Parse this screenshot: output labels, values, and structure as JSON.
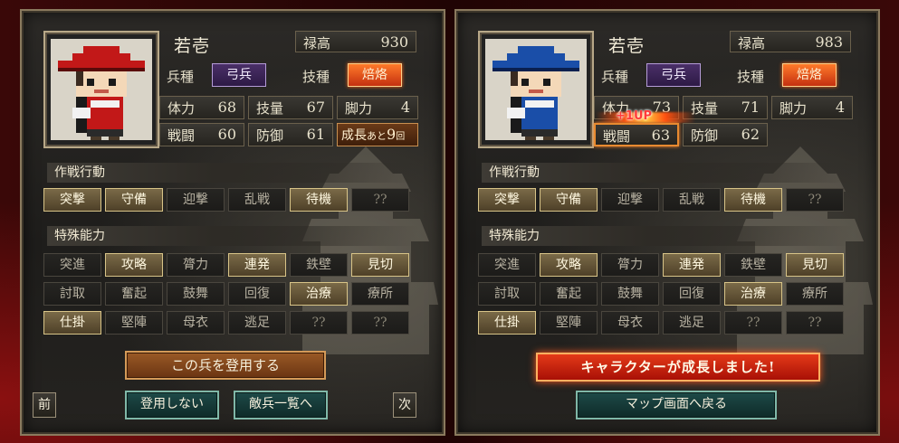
{
  "panels": [
    {
      "name": "若壱",
      "salary_label": "禄高",
      "salary": "930",
      "unit_type_label": "兵種",
      "unit_type": "弓兵",
      "skill_label": "技種",
      "skill": "焙烙",
      "stats": {
        "hp_label": "体力",
        "hp": "68",
        "tech_label": "技量",
        "tech": "67",
        "leg_label": "脚力",
        "leg": "4",
        "atk_label": "戦闘",
        "atk": "60",
        "def_label": "防御",
        "def": "61"
      },
      "growth_prefix": "成長",
      "growth_small": "あと",
      "growth_num": "9",
      "growth_suffix": "回",
      "hat_color": "#c21818",
      "clothes_color": "#c21818",
      "tactics_title": "作戦行動",
      "tactics": [
        {
          "label": "突撃",
          "on": true
        },
        {
          "label": "守備",
          "on": true
        },
        {
          "label": "迎撃",
          "on": false
        },
        {
          "label": "乱戦",
          "on": false
        },
        {
          "label": "待機",
          "on": true
        },
        {
          "label": "??",
          "on": false
        }
      ],
      "abilities_title": "特殊能力",
      "abilities": [
        {
          "label": "突進",
          "on": false
        },
        {
          "label": "攻略",
          "on": true
        },
        {
          "label": "膂力",
          "on": false
        },
        {
          "label": "連発",
          "on": true
        },
        {
          "label": "鉄壁",
          "on": false
        },
        {
          "label": "見切",
          "on": true
        },
        {
          "label": "討取",
          "on": false
        },
        {
          "label": "奮起",
          "on": false
        },
        {
          "label": "鼓舞",
          "on": false
        },
        {
          "label": "回復",
          "on": false
        },
        {
          "label": "治療",
          "on": true
        },
        {
          "label": "療所",
          "on": false
        },
        {
          "label": "仕掛",
          "on": true
        },
        {
          "label": "堅陣",
          "on": false
        },
        {
          "label": "母衣",
          "on": false
        },
        {
          "label": "逃足",
          "on": false
        },
        {
          "label": "??",
          "on": false
        },
        {
          "label": "??",
          "on": false
        }
      ],
      "register_btn": "この兵を登用する",
      "prev_btn": "前",
      "next_btn": "次",
      "decline_btn": "登用しない",
      "enemy_list_btn": "敵兵一覧へ"
    },
    {
      "name": "若壱",
      "salary_label": "禄高",
      "salary": "983",
      "unit_type_label": "兵種",
      "unit_type": "弓兵",
      "skill_label": "技種",
      "skill": "焙烙",
      "stats": {
        "hp_label": "体力",
        "hp": "73",
        "tech_label": "技量",
        "tech": "71",
        "leg_label": "脚力",
        "leg": "4",
        "atk_label": "戦闘",
        "atk": "63",
        "def_label": "防御",
        "def": "62"
      },
      "levelup_text": "+1UP",
      "hat_color": "#1a4ea8",
      "clothes_color": "#1a4ea8",
      "tactics_title": "作戦行動",
      "tactics": [
        {
          "label": "突撃",
          "on": true
        },
        {
          "label": "守備",
          "on": true
        },
        {
          "label": "迎撃",
          "on": false
        },
        {
          "label": "乱戦",
          "on": false
        },
        {
          "label": "待機",
          "on": true
        },
        {
          "label": "??",
          "on": false
        }
      ],
      "abilities_title": "特殊能力",
      "abilities": [
        {
          "label": "突進",
          "on": false
        },
        {
          "label": "攻略",
          "on": true
        },
        {
          "label": "膂力",
          "on": false
        },
        {
          "label": "連発",
          "on": true
        },
        {
          "label": "鉄壁",
          "on": false
        },
        {
          "label": "見切",
          "on": true
        },
        {
          "label": "討取",
          "on": false
        },
        {
          "label": "奮起",
          "on": false
        },
        {
          "label": "鼓舞",
          "on": false
        },
        {
          "label": "回復",
          "on": false
        },
        {
          "label": "治療",
          "on": true
        },
        {
          "label": "療所",
          "on": false
        },
        {
          "label": "仕掛",
          "on": true
        },
        {
          "label": "堅陣",
          "on": false
        },
        {
          "label": "母衣",
          "on": false
        },
        {
          "label": "逃足",
          "on": false
        },
        {
          "label": "??",
          "on": false
        },
        {
          "label": "??",
          "on": false
        }
      ],
      "growth_banner": "キャラクターが成長しました!",
      "return_btn": "マップ画面へ戻る"
    }
  ]
}
